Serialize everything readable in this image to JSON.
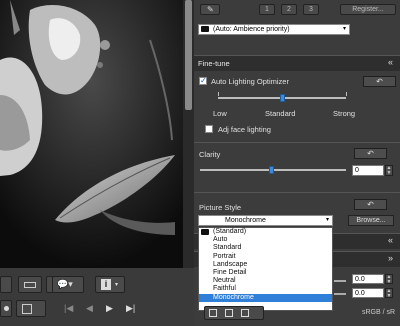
{
  "panel": {
    "top_buttons": {
      "btn1": "1",
      "btn2": "2",
      "btn3": "3",
      "register": "Register..."
    },
    "preset_combo": "(Auto: Ambience priority)",
    "finetune": {
      "title": "Fine-tune",
      "alo_label": "Auto Lighting Optimizer",
      "alo_checked": true,
      "levels": [
        "Low",
        "Standard",
        "Strong"
      ],
      "alo_level": "Standard",
      "face_label": "Adj face lighting",
      "face_checked": false
    },
    "clarity": {
      "title": "Clarity",
      "value": "0"
    },
    "picture_style": {
      "title": "Picture Style",
      "selected": "Monochrome",
      "browse_label": "Browse...",
      "options": [
        "(Standard)",
        "Auto",
        "Standard",
        "Portrait",
        "Landscape",
        "Fine Detail",
        "Neutral",
        "Faithful",
        "Monochrome"
      ]
    },
    "value_boxes": [
      "0.0",
      "0.0"
    ],
    "status_text": "sRGB / sR"
  },
  "toolbar": {
    "info_icon": "info-icon",
    "nav": [
      "first-icon",
      "prev-icon",
      "next-icon",
      "last-icon"
    ]
  },
  "colors": {
    "accent": "#2f7fd8",
    "panel_bg": "#3c3c3c",
    "header_bg": "#2e2e2e"
  }
}
